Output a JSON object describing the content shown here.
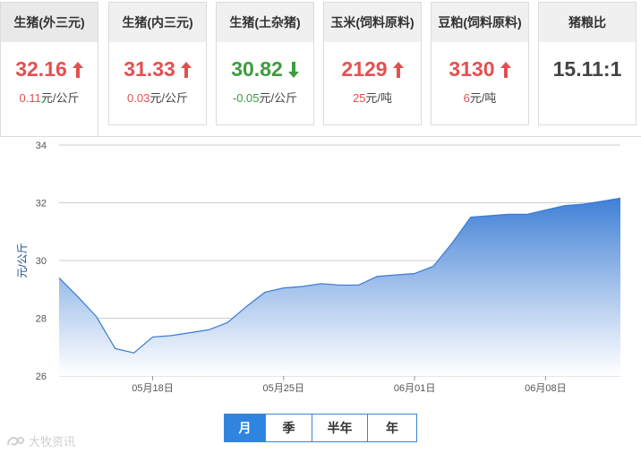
{
  "cards": [
    {
      "title": "生猪(外三元)",
      "price": "32.16",
      "direction": "up",
      "change": "0.11",
      "unit": "元/公斤"
    },
    {
      "title": "生猪(内三元)",
      "price": "31.33",
      "direction": "up",
      "change": "0.03",
      "unit": "元/公斤"
    },
    {
      "title": "生猪(土杂猪)",
      "price": "30.82",
      "direction": "down",
      "change": "-0.05",
      "unit": "元/公斤"
    },
    {
      "title": "玉米(饲料原料)",
      "price": "2129",
      "direction": "up",
      "change": "25",
      "unit": "元/吨"
    },
    {
      "title": "豆粕(饲料原料)",
      "price": "3130",
      "direction": "up",
      "change": "6",
      "unit": "元/吨"
    },
    {
      "title": "猪粮比",
      "price": "15.11:1",
      "direction": "none",
      "change": "",
      "unit": ""
    }
  ],
  "colors": {
    "up": "#e45050",
    "down": "#3e9c3e",
    "accent": "#2f84e0",
    "area_top": "#3f7fd6",
    "area_bottom": "#ffffff"
  },
  "chart_data": {
    "type": "area",
    "title": "",
    "ylabel": "元/公斤",
    "xlabel": "",
    "ylim": [
      26,
      34
    ],
    "yticks": [
      26,
      28,
      30,
      32,
      34
    ],
    "xtick_labels": [
      {
        "i": 5,
        "label": "05月18日"
      },
      {
        "i": 12,
        "label": "05月25日"
      },
      {
        "i": 19,
        "label": "06月01日"
      },
      {
        "i": 26,
        "label": "06月08日"
      }
    ],
    "grid": true,
    "values": [
      29.4,
      28.75,
      28.05,
      26.95,
      26.8,
      27.35,
      27.4,
      27.5,
      27.6,
      27.85,
      28.4,
      28.9,
      29.05,
      29.1,
      29.2,
      29.15,
      29.15,
      29.45,
      29.5,
      29.55,
      29.8,
      30.6,
      31.5,
      31.55,
      31.6,
      31.6,
      31.75,
      31.9,
      31.95,
      32.05,
      32.16
    ]
  },
  "tabs": [
    {
      "label": "月",
      "active": true
    },
    {
      "label": "季",
      "active": false
    },
    {
      "label": "半年",
      "active": false
    },
    {
      "label": "年",
      "active": false
    }
  ],
  "watermark": "大牧资讯"
}
